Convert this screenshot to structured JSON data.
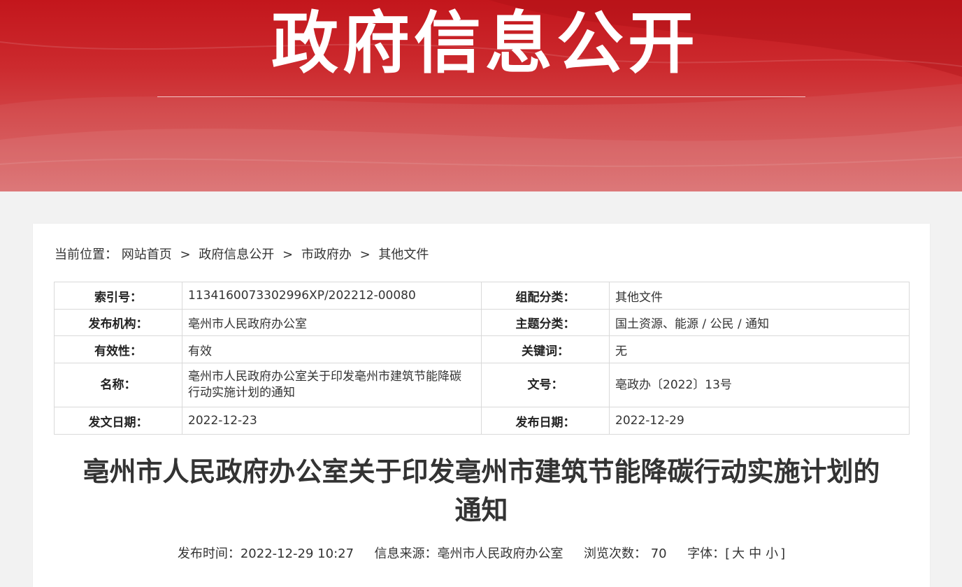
{
  "banner": {
    "title": "政府信息公开"
  },
  "breadcrumb": {
    "prefix": "当前位置：",
    "items": [
      "网站首页",
      "政府信息公开",
      "市政府办",
      "其他文件"
    ],
    "separator": ">"
  },
  "meta": {
    "index_no_label": "索引号：",
    "index_no": "1134160073302996XP/202212-00080",
    "category_label": "组配分类：",
    "category": "其他文件",
    "publisher_label": "发布机构：",
    "publisher": "亳州市人民政府办公室",
    "topic_label": "主题分类：",
    "topic": "国土资源、能源 / 公民 / 通知",
    "validity_label": "有效性：",
    "validity": "有效",
    "keywords_label": "关键词：",
    "keywords": "无",
    "name_label": "名称：",
    "name_line1": "亳州市人民政府办公室关于印发亳州市建筑节能降碳",
    "name_line2": "行动实施计划的通知",
    "doc_no_label": "文号：",
    "doc_no": "亳政办〔2022〕13号",
    "issue_date_label": "发文日期：",
    "issue_date": "2022-12-23",
    "publish_date_label": "发布日期：",
    "publish_date": "2022-12-29"
  },
  "article": {
    "title_line1": "亳州市人民政府办公室关于印发亳州市建筑节能降碳行动实施计划的",
    "title_line2": "通知",
    "publish_time_label": "发布时间：",
    "publish_time": "2022-12-29 10:27",
    "source_label": "信息来源：",
    "source": "亳州市人民政府办公室",
    "views_label": "浏览次数：",
    "views": "70",
    "font_label": "字体：",
    "font_open": "[",
    "font_large": "大",
    "font_medium": "中",
    "font_small": "小",
    "font_close": "]"
  },
  "colors": {
    "banner_red": "#c3161c",
    "text": "#333333",
    "border": "#d9d9d9",
    "page_bg": "#f2f2f2"
  }
}
